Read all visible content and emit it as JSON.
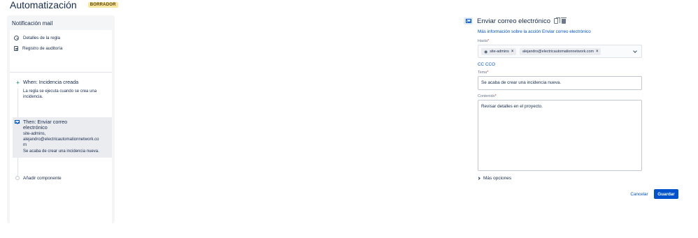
{
  "header": {
    "title": "Automatización",
    "badge": "BORRADOR"
  },
  "sidebar": {
    "rule_name": "Notificación mail",
    "nav": [
      {
        "label": "Detalles de la regla",
        "icon": "info-icon"
      },
      {
        "label": "Registro de auditoría",
        "icon": "document-icon"
      }
    ],
    "trigger": {
      "title": "When: Incidencia creada",
      "desc_lines": [
        "La regla se ejecuta cuando se crea una",
        "incidencia."
      ]
    },
    "action": {
      "title_lines": [
        "Then: Enviar correo",
        "electrónico"
      ],
      "desc_lines": [
        "site-admins,",
        "alejandro@electricautomationnetwork.co",
        "m",
        "Se acaba de crear una incidencia nueva."
      ]
    },
    "add_component": "Añadir componente"
  },
  "form": {
    "title": "Enviar correo electrónico",
    "info_link": "Más información sobre la acción Enviar correo electrónico",
    "to_label": "Hasta",
    "to_chips": [
      "site-admins",
      "alejandro@electricautomationnetwork.com"
    ],
    "cc": "CC",
    "cco": "CCO",
    "subject_label": "Tema",
    "subject_value": "Se acaba de crear una incidencia nueva.",
    "content_label": "Contenido",
    "content_value": "Revisar detalles en el proyecto.",
    "more_options": "Más opciones",
    "cancel": "Cancelar",
    "save": "Guardar"
  },
  "colors": {
    "primary": "#0052cc",
    "badge_bg": "#f8e6a0",
    "trigger_green": "#36b37e"
  }
}
